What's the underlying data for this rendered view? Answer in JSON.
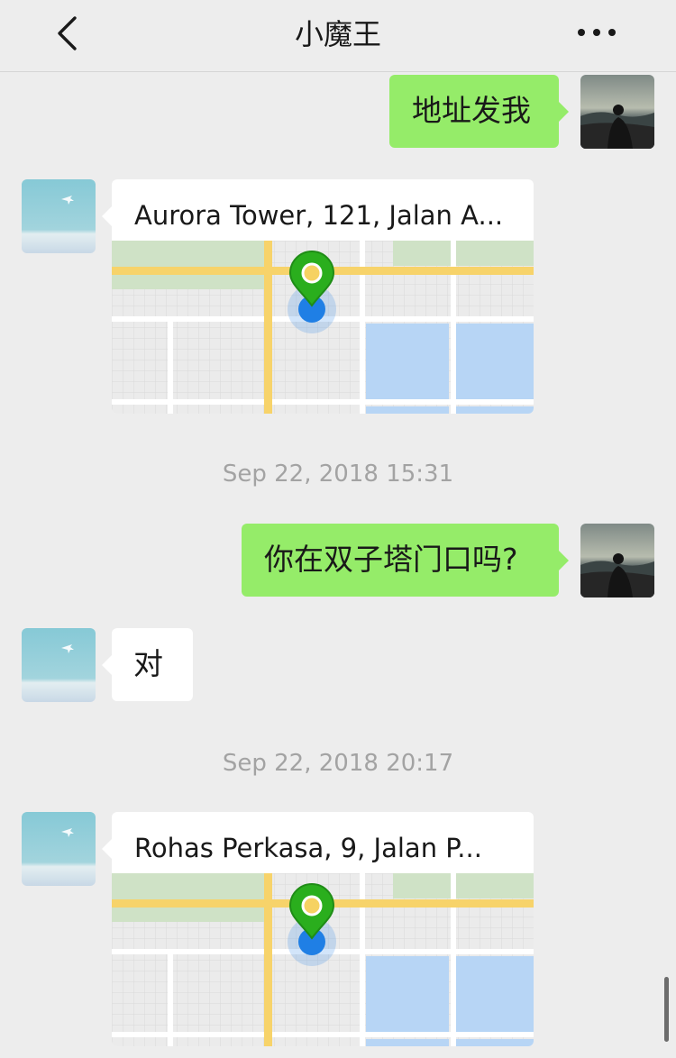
{
  "header": {
    "title": "小魔王"
  },
  "messages": [
    {
      "type": "text",
      "side": "right",
      "text": "地址发我"
    },
    {
      "type": "location",
      "side": "left",
      "address": "Aurora Tower, 121, Jalan A..."
    },
    {
      "type": "timestamp",
      "text": "Sep 22, 2018 15:31"
    },
    {
      "type": "text",
      "side": "right",
      "text": "你在双子塔门口吗?"
    },
    {
      "type": "text",
      "side": "left",
      "text": "对"
    },
    {
      "type": "timestamp",
      "text": "Sep 22, 2018 20:17"
    },
    {
      "type": "location",
      "side": "left",
      "address": "Rohas Perkasa, 9, Jalan P..."
    }
  ],
  "icons": {
    "back": "chevron-left-icon",
    "more": "more-horizontal-icon",
    "pin": "map-pin-icon"
  },
  "colors": {
    "background": "#ededed",
    "sent_bubble": "#95ec69",
    "received_bubble": "#ffffff",
    "timestamp": "#a3a3a3",
    "pin": "#2aae1d",
    "location_dot": "#1f7fe5"
  }
}
